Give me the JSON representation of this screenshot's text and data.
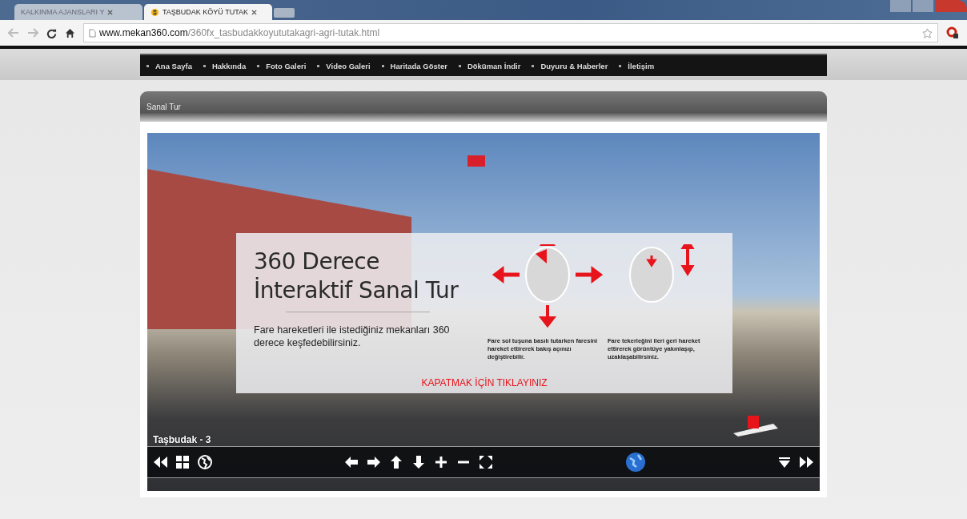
{
  "browser": {
    "tabs": [
      {
        "title": "KALKINMA AJANSLARI Y",
        "selected": false
      },
      {
        "title": "TAŞBUDAK KÖYÜ TUTAK",
        "selected": true
      }
    ],
    "url_host": "www.mekan360.com",
    "url_path": "/360fx_tasbudakkoyututakagri-agri-tutak.html"
  },
  "nav": {
    "items": [
      "Ana Sayfa",
      "Hakkında",
      "Foto Galeri",
      "Video Galeri",
      "Haritada Göster",
      "Döküman İndir",
      "Duyuru & Haberler",
      "İletişim"
    ]
  },
  "section": {
    "title": "Sanal Tur"
  },
  "tour": {
    "overlay": {
      "title_lines": [
        "360 Derece",
        "İnteraktif Sanal Tur"
      ],
      "description": "Fare hareketleri ile istediğiniz mekanları 360 derece keşfedebilirsiniz.",
      "hints": [
        "Fare sol tuşuna basılı tutarken faresini hareket ettirerek bakış açınızı değiştirebilir.",
        "Fare tekerleğini ileri geri hareket ettirerek görüntüye yakınlaşıp, uzaklaşabilirsiniz."
      ],
      "close_link": "KAPATMAK İÇİN TIKLAYINIZ"
    },
    "scene_label": "Taşbudak - 3"
  }
}
